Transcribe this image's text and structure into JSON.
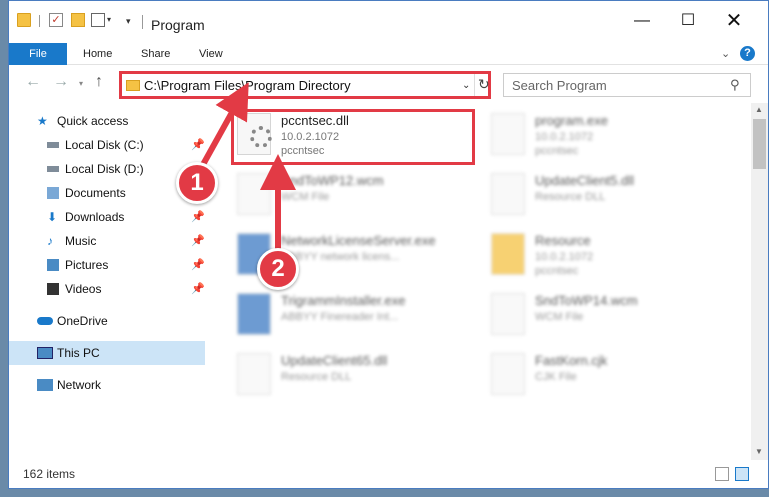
{
  "window": {
    "title": "Program",
    "qa_check_glyph": "✓",
    "minimize": "—",
    "maximize": "☐",
    "close": "✕"
  },
  "ribbon": {
    "tabs": [
      "File",
      "Home",
      "Share",
      "View"
    ],
    "help": "?"
  },
  "nav": {
    "back": "←",
    "forward": "→",
    "up": "↑",
    "address": "C:\\Program Files\\Program Directory",
    "search_placeholder": "Search Program"
  },
  "sidebar": {
    "items": [
      {
        "label": "Quick access",
        "icon": "star-icon",
        "pinned": false
      },
      {
        "label": "Local Disk (C:)",
        "icon": "disk-icon",
        "pinned": true
      },
      {
        "label": "Local Disk (D:)",
        "icon": "disk-icon",
        "pinned": false
      },
      {
        "label": "Documents",
        "icon": "documents-icon",
        "pinned": true
      },
      {
        "label": "Downloads",
        "icon": "downloads-icon",
        "pinned": true
      },
      {
        "label": "Music",
        "icon": "music-icon",
        "pinned": true
      },
      {
        "label": "Pictures",
        "icon": "pictures-icon",
        "pinned": true
      },
      {
        "label": "Videos",
        "icon": "videos-icon",
        "pinned": true
      },
      {
        "label": "OneDrive",
        "icon": "onedrive-icon",
        "pinned": false
      },
      {
        "label": "This PC",
        "icon": "pc-icon",
        "pinned": false,
        "selected": true
      },
      {
        "label": "Network",
        "icon": "network-icon",
        "pinned": false
      }
    ]
  },
  "files": [
    {
      "name": "pccntsec.dll",
      "line2": "10.0.2.1072",
      "line3": "pccntsec",
      "highlighted": true
    },
    {
      "name": "program.exe",
      "line2": "10.0.2.1072",
      "line3": "pccntsec"
    },
    {
      "name": "SndToWP12.wcm",
      "line2": "WCM File",
      "line3": ""
    },
    {
      "name": "UpdateClient5.dll",
      "line2": "Resource DLL",
      "line3": ""
    },
    {
      "name": "NetworkLicenseServer.exe",
      "line2": "ABBYY network licens...",
      "line3": ""
    },
    {
      "name": "Resource",
      "line2": "10.0.2.1072",
      "line3": "pccntsec"
    },
    {
      "name": "TrigrammInstaller.exe",
      "line2": "ABBYY Finereader Int...",
      "line3": ""
    },
    {
      "name": "SndToWP14.wcm",
      "line2": "WCM File",
      "line3": ""
    },
    {
      "name": "UpdateClient65.dll",
      "line2": "Resource DLL",
      "line3": ""
    },
    {
      "name": "FastKorn.cjk",
      "line2": "CJK File",
      "line3": ""
    }
  ],
  "status": {
    "item_count": "162 items"
  },
  "annotations": {
    "badge1": "1",
    "badge2": "2",
    "color": "#e23a45"
  }
}
